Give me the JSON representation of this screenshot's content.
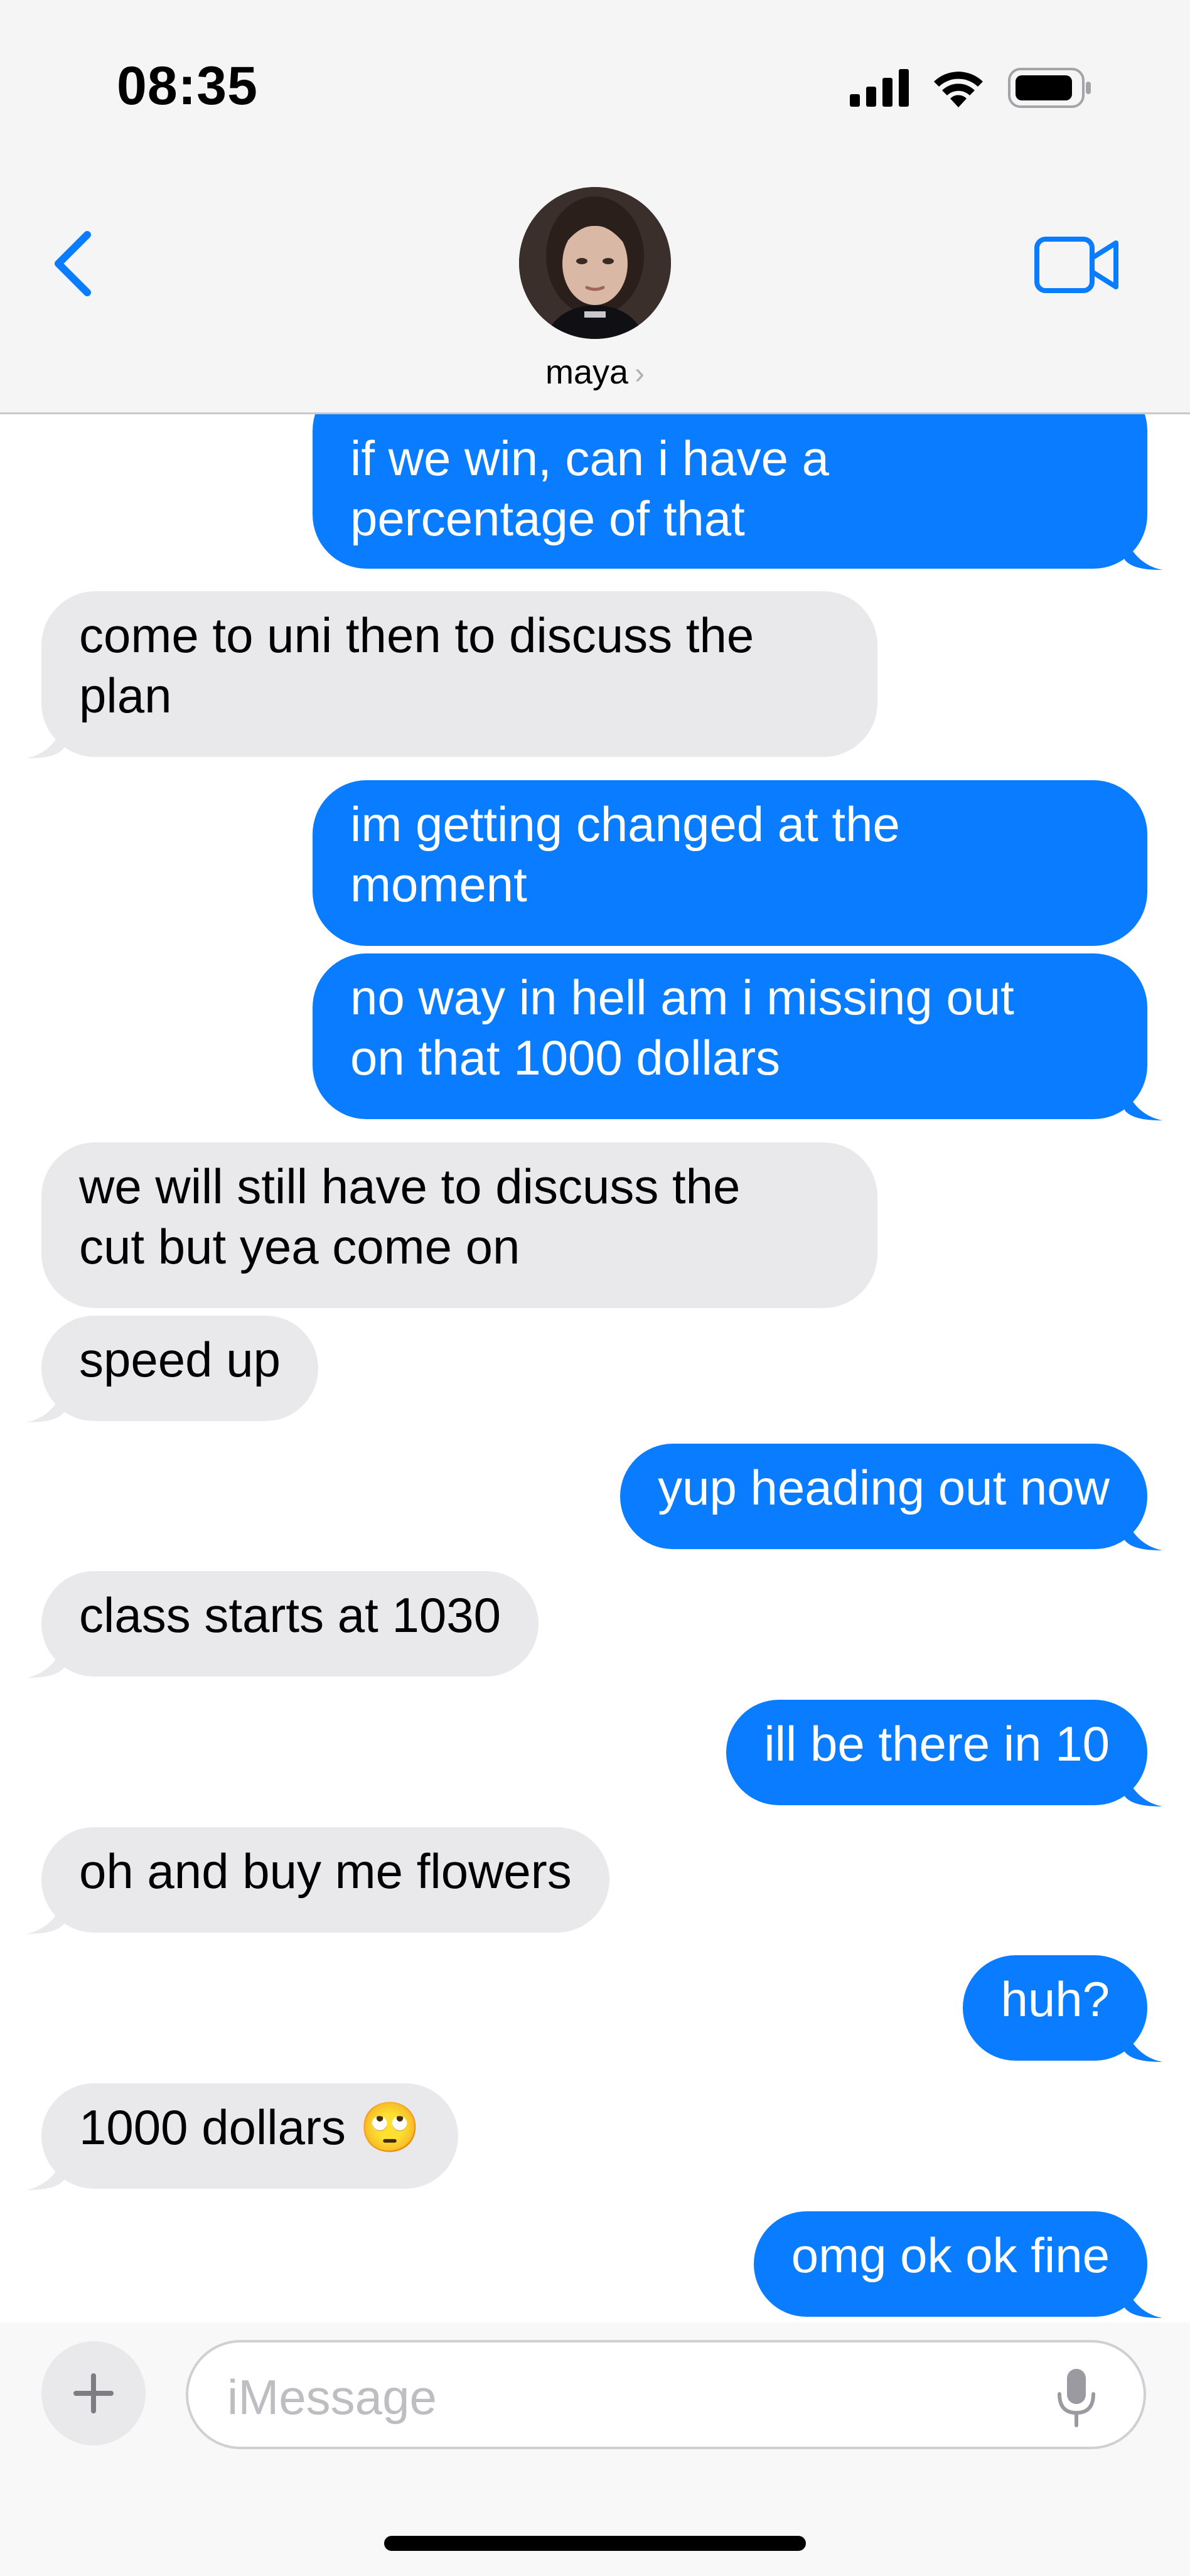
{
  "status_bar": {
    "time": "08:35"
  },
  "contact": {
    "name": "maya",
    "chevron": "›"
  },
  "icons": {
    "back": "chevron-left-icon",
    "video": "video-camera-icon",
    "signal": "cellular-signal-icon",
    "wifi": "wifi-icon",
    "battery": "battery-icon",
    "plus": "plus-icon",
    "mic": "microphone-icon"
  },
  "colors": {
    "sent_bubble": "#0a7cff",
    "received_bubble": "#e9e9eb",
    "accent": "#0a7cff"
  },
  "messages": [
    {
      "from": "me",
      "text": "if we win, can i have a\npercentage of that"
    },
    {
      "from": "maya",
      "text": "come to uni then to discuss the\nplan"
    },
    {
      "from": "me",
      "text": "im getting changed at the\nmoment"
    },
    {
      "from": "me",
      "text": "no way in hell am i missing out\non that 1000 dollars"
    },
    {
      "from": "maya",
      "text": "we will still have to discuss the\ncut but yea come on"
    },
    {
      "from": "maya",
      "text": "speed up"
    },
    {
      "from": "me",
      "text": "yup heading out now"
    },
    {
      "from": "maya",
      "text": "class starts at 1030"
    },
    {
      "from": "me",
      "text": "ill be there in 10"
    },
    {
      "from": "maya",
      "text": "oh and buy me flowers"
    },
    {
      "from": "me",
      "text": "huh?"
    },
    {
      "from": "maya",
      "text": "1000 dollars 🙄"
    },
    {
      "from": "me",
      "text": "omg ok ok fine"
    }
  ],
  "input": {
    "placeholder": "iMessage"
  }
}
